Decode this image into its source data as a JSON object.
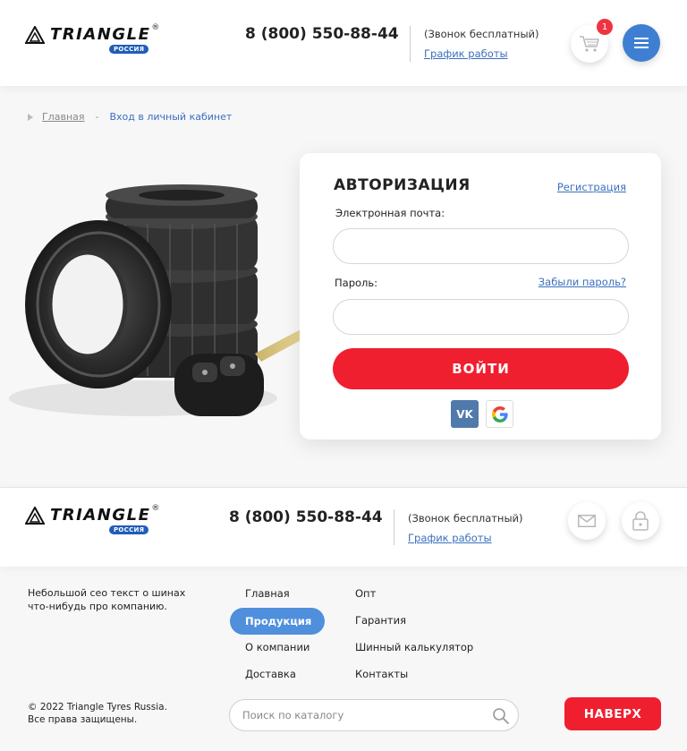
{
  "header": {
    "logo_text": "TRIANGLE",
    "logo_reg": "®",
    "logo_badge": "РОССИЯ",
    "phone": "8 (800) 550-88-44",
    "free_call": "(Звонок бесплатный)",
    "schedule": "График работы",
    "cart_count": "1"
  },
  "breadcrumb": {
    "home": "Главная",
    "separator": "-",
    "current": "Вход в личный кабинет"
  },
  "login": {
    "title": "АВТОРИЗАЦИЯ",
    "register_link": "Регистрация",
    "email_label": "Электронная почта:",
    "email_value": "",
    "password_label": "Пароль:",
    "password_value": "",
    "forgot_link": "Забыли пароль?",
    "submit": "ВОЙТИ",
    "vk_label": "VK"
  },
  "footer": {
    "logo_text": "TRIANGLE",
    "logo_reg": "®",
    "logo_badge": "РОССИЯ",
    "phone": "8 (800) 550-88-44",
    "free_call": "(Звонок бесплатный)",
    "schedule": "График работы",
    "seo_text": "Небольшой сео текст о шинах что-нибудь про компанию.",
    "nav_col1": [
      "Главная",
      "Продукция",
      "О компании",
      "Доставка"
    ],
    "nav_col2": [
      "Опт",
      "Гарантия",
      "Шинный калькулятор",
      "Контакты"
    ],
    "copyright_line1": "© 2022 Triangle Tyres Russia.",
    "copyright_line2": "Все права защищены.",
    "search_placeholder": "Поиск по каталогу",
    "to_top": "НАВЕРХ"
  },
  "colors": {
    "accent_red": "#ef1f2f",
    "accent_blue": "#3f7fd3",
    "link_blue": "#3a6fbd",
    "logo_badge_blue": "#1f5db8",
    "vk_blue": "#4f7aab"
  },
  "icons": {
    "cart": "cart-icon",
    "menu": "hamburger-icon",
    "mail": "mail-icon",
    "lock": "lock-icon",
    "search": "search-icon",
    "vk": "vk-icon",
    "google": "google-icon"
  }
}
